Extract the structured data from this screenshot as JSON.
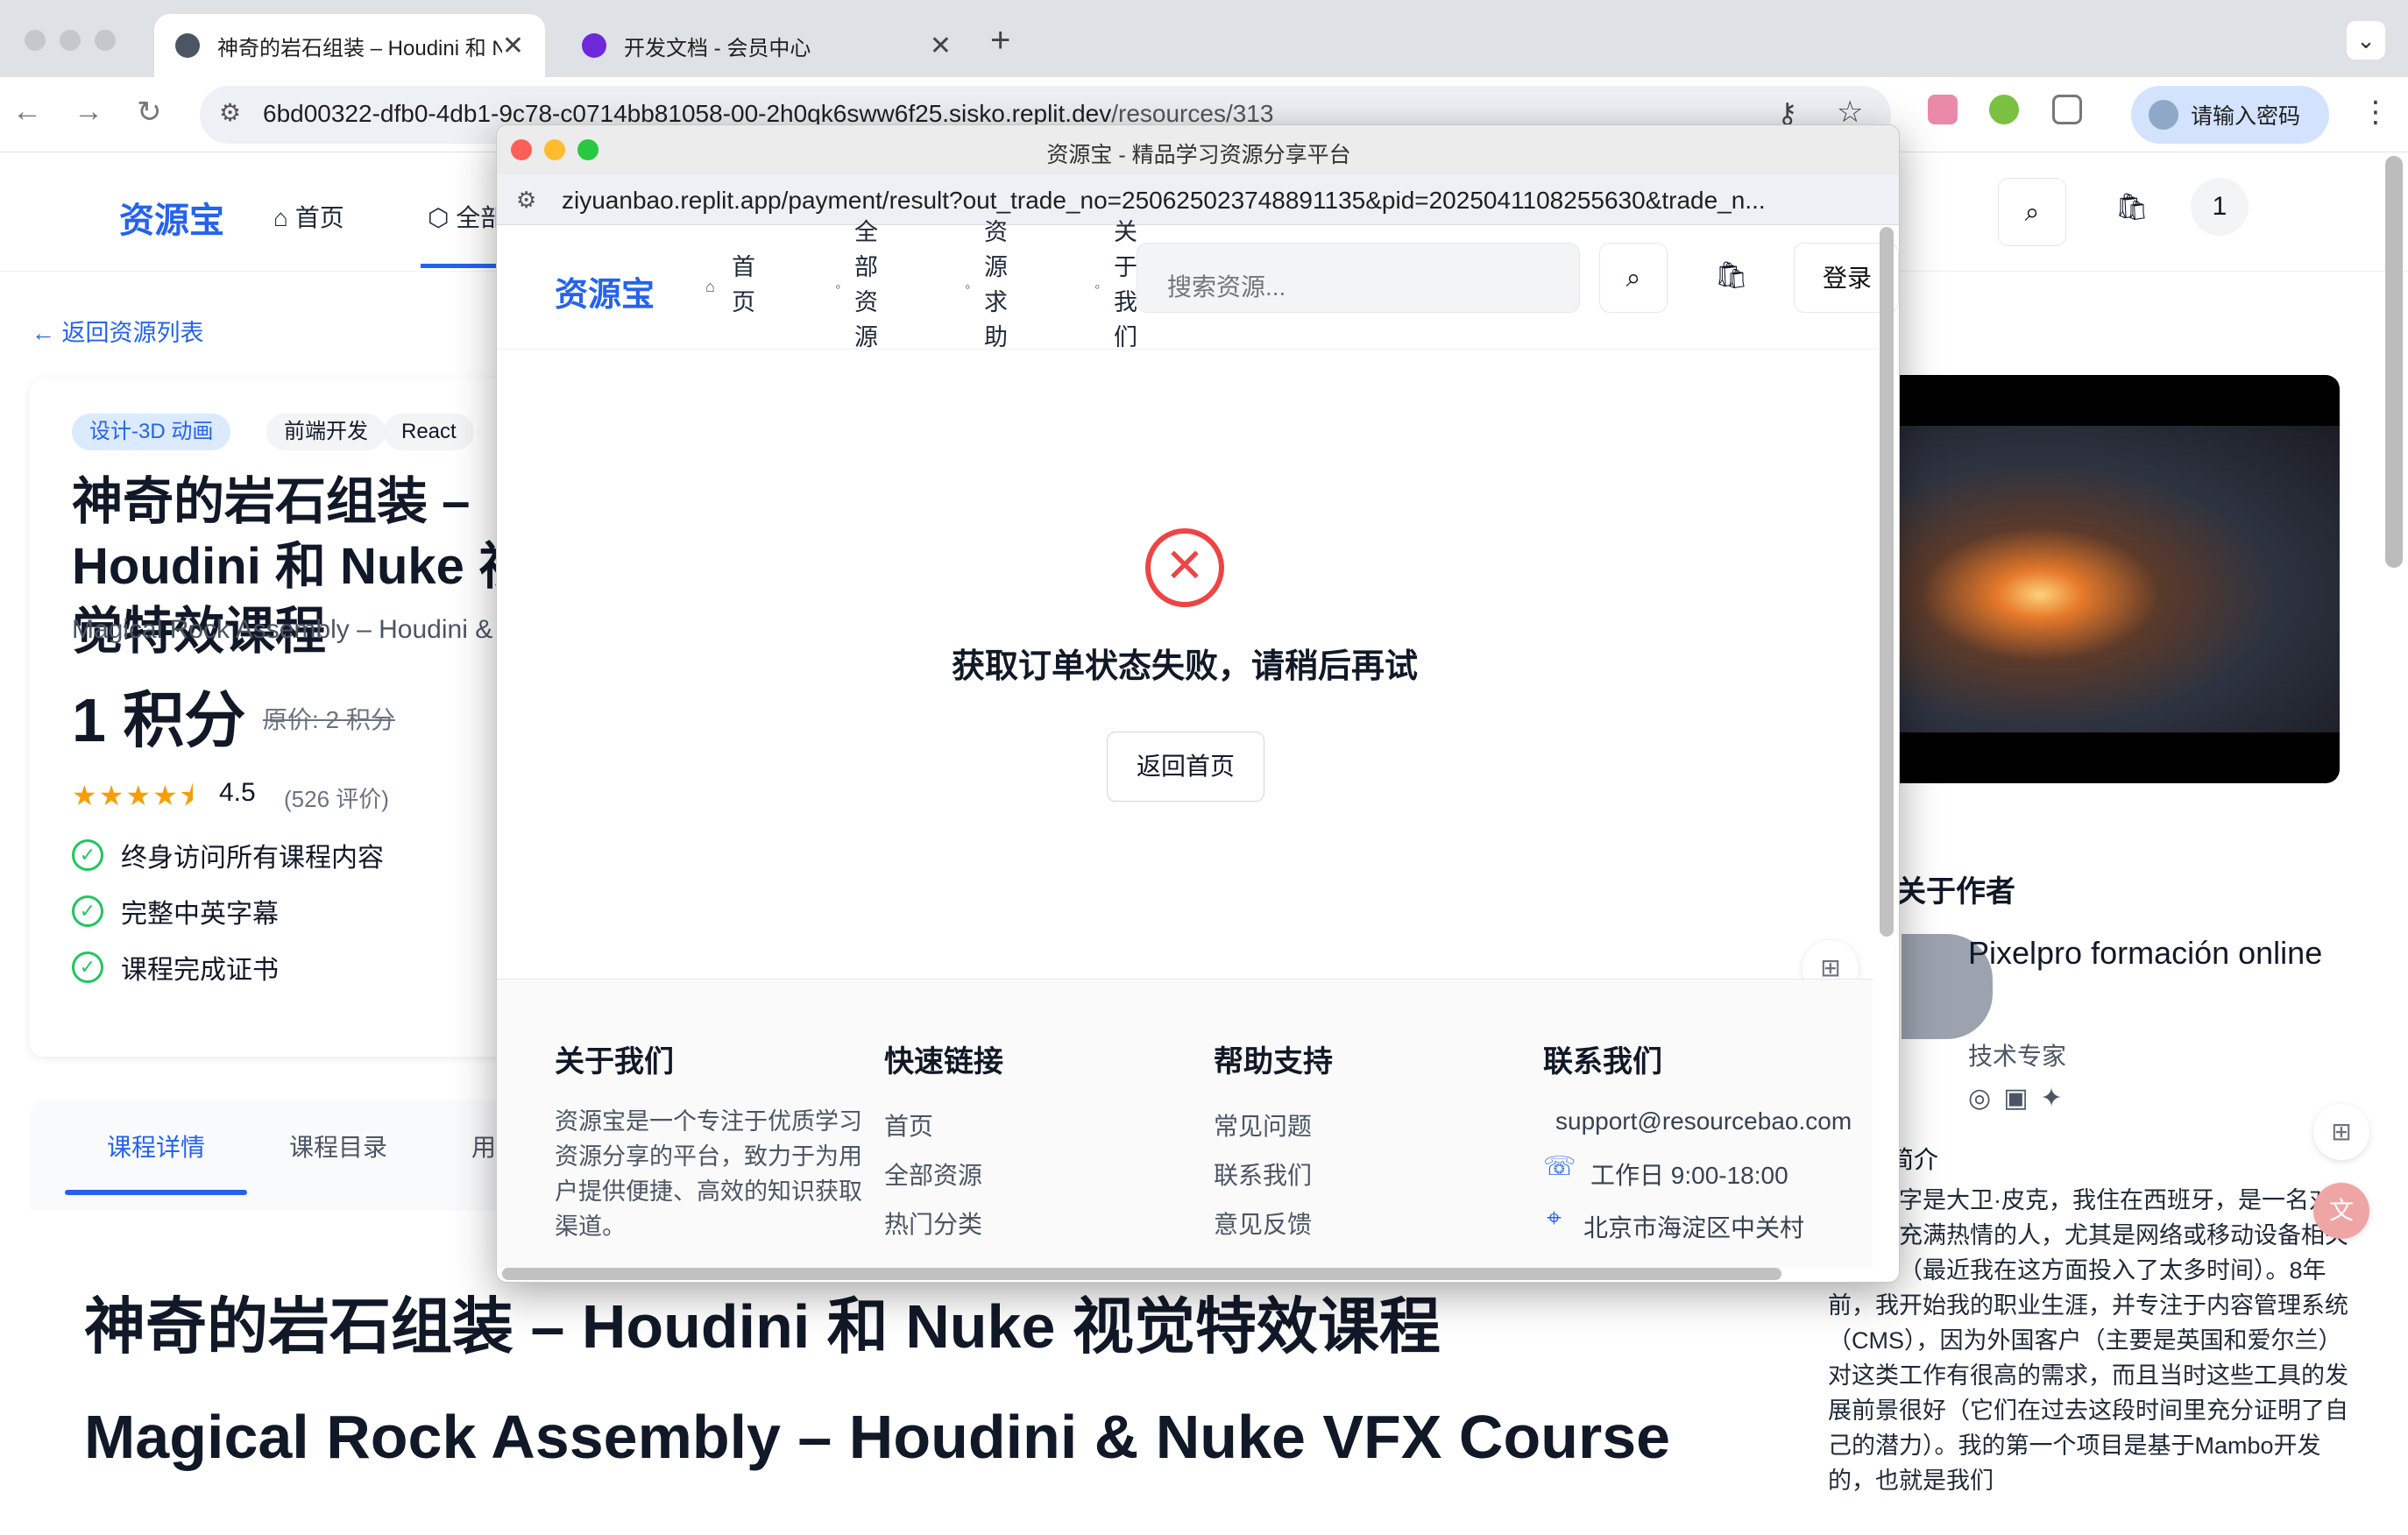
{
  "browser": {
    "tabs": [
      {
        "title": "神奇的岩石组装 – Houdini 和 N",
        "active": true
      },
      {
        "title": "开发文档 - 会员中心",
        "active": false
      }
    ],
    "url_host": "6bd00322-dfb0-4db1-9c78-c0714bb81058-00-2h0qk6sww6f25.sisko.replit.dev",
    "url_path": "/resources/313",
    "password_prompt": "请输入密码",
    "new_tab": "+",
    "tab_close": "✕",
    "tab_menu": "⌄"
  },
  "page": {
    "logo": "资源宝",
    "nav": {
      "home": "首页",
      "all": "全部资源"
    },
    "cart_count": "1",
    "back_link": "返回资源列表",
    "tags": [
      "设计-3D 动画",
      "前端开发",
      "React"
    ],
    "course_title": "神奇的岩石组装 – Houdini 和 Nuke 视觉特效课程",
    "course_subtitle": "Magical Rock Assembly – Houdini & Nuke VFX Course",
    "price": "1 积分",
    "original_price": "原价: 2 积分",
    "rating": "4.5",
    "rating_stars": 4.5,
    "reviews": "(526 评价)",
    "features": [
      "终身访问所有课程内容",
      "完整中英字幕",
      "课程完成证书"
    ],
    "detail_tabs": [
      "课程详情",
      "课程目录",
      "用户评价"
    ],
    "detail_title_cn": "神奇的岩石组装 – Houdini 和 Nuke 视觉特效课程",
    "detail_title_en": "Magical Rock Assembly – Houdini & Nuke VFX Course",
    "author": {
      "heading": "关于作者",
      "name": "Pixelpro formación online",
      "role": "技术专家",
      "intro_heading": "简介",
      "bio": "我的名字是大卫·皮克，我住在西班牙，是一名对新技术充满热情的人，尤其是网络或移动设备相关的内容（最近我在这方面投入了太多时间）。8年前，我开始我的职业生涯，并专注于内容管理系统（CMS），因为外国客户（主要是英国和爱尔兰）对这类工作有很高的需求，而且当时这些工具的发展前景很好（它们在过去这段时间里充分证明了自己的潜力）。我的第一个项目是基于Mambo开发的，也就是我们"
    }
  },
  "popup": {
    "window_title": "资源宝 - 精品学习资源分享平台",
    "url": "ziyuanbao.replit.app/payment/result?out_trade_no=250625023748891135&pid=2025041108255630&trade_n...",
    "logo": "资源宝",
    "nav": [
      "首页",
      "全部资源",
      "资源求助",
      "关于我们"
    ],
    "search_placeholder": "搜索资源...",
    "login": "登录",
    "error_message": "获取订单状态失败，请稍后再试",
    "home_button": "返回首页",
    "footer": {
      "about_heading": "关于我们",
      "about_text": "资源宝是一个专注于优质学习资源分享的平台，致力于为用户提供便捷、高效的知识获取渠道。",
      "quick_heading": "快速链接",
      "quick_links": [
        "首页",
        "全部资源",
        "热门分类"
      ],
      "help_heading": "帮助支持",
      "help_links": [
        "常见问题",
        "联系我们",
        "意见反馈"
      ],
      "contact_heading": "联系我们",
      "email": "support@resourcebao.com",
      "hours": "工作日 9:00-18:00",
      "address": "北京市海淀区中关村"
    }
  },
  "colors": {
    "accent": "#2563eb",
    "error": "#ef4444",
    "success": "#22c55e",
    "star": "#f59e0b"
  },
  "icons": {
    "back": "←",
    "forward": "→",
    "reload": "↻",
    "close_x": "✕",
    "check": "✓",
    "search": "⌕",
    "cart": "🛍",
    "arrow_left": "←",
    "phone": "☏",
    "pin": "⌖"
  }
}
